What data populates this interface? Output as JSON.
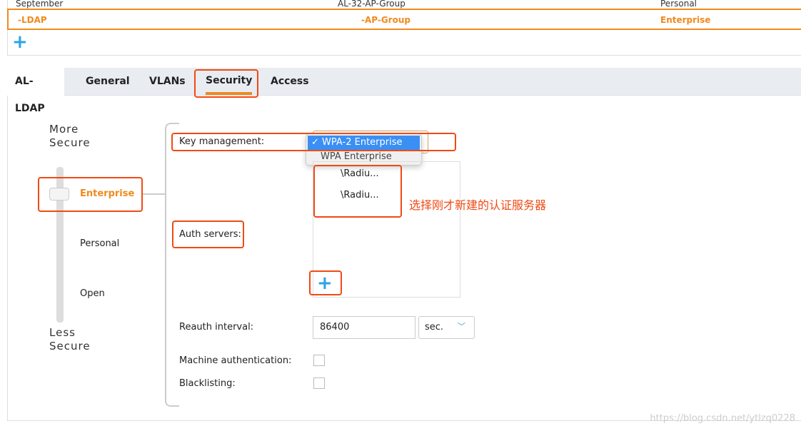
{
  "table": {
    "prev_row": [
      "September",
      "AL-32-AP-Group",
      "Personal"
    ],
    "selected_row": [
      "-LDAP",
      "-AP-Group",
      "Enterprise"
    ],
    "add_icon": "plus-icon"
  },
  "tabs": {
    "current": "AL-LDAP",
    "items": [
      "General",
      "VLANs",
      "Security",
      "Access"
    ],
    "active": "Security"
  },
  "security": {
    "more_secure": "More Secure",
    "less_secure": "Less Secure",
    "levels": [
      "Enterprise",
      "Personal",
      "Open"
    ],
    "selected_level": "Enterprise",
    "key_management_label": "Key management:",
    "key_management_options": [
      "WPA-2 Enterprise",
      "WPA Enterprise"
    ],
    "key_management_selected": "WPA-2 Enterprise",
    "check": "✓",
    "auth_servers_label": "Auth servers:",
    "auth_servers": [
      "\\Radiu...",
      "\\Radiu..."
    ],
    "reauth_label": "Reauth interval:",
    "reauth_value": "86400",
    "reauth_unit": "sec.",
    "machine_auth_label": "Machine authentication:",
    "machine_auth_checked": false,
    "blacklisting_label": "Blacklisting:",
    "blacklisting_checked": false
  },
  "annotation": "选择刚才新建的认证服务器",
  "watermark": "https://blog.csdn.net/ytlzq0228",
  "colors": {
    "accent": "#f08a1c",
    "highlight": "#f04a14",
    "plus": "#2aa3e8",
    "selected_option": "#3a8ff5"
  }
}
